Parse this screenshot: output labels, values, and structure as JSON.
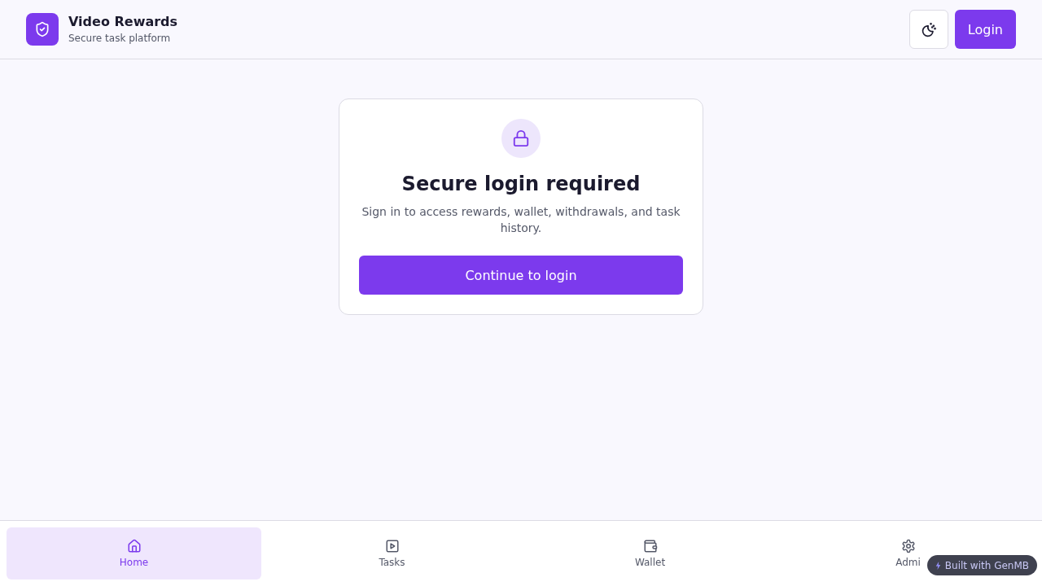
{
  "header": {
    "title": "Video Rewards",
    "subtitle": "Secure task platform",
    "login_button": "Login"
  },
  "card": {
    "title": "Secure login required",
    "description": "Sign in to access rewards, wallet, withdrawals, and task history.",
    "button": "Continue to login"
  },
  "bottom_nav": [
    {
      "label": "Home",
      "selected": true
    },
    {
      "label": "Tasks",
      "selected": false
    },
    {
      "label": "Wallet",
      "selected": false
    },
    {
      "label": "Admi",
      "selected": false
    }
  ],
  "badge": {
    "text": "Built with GenMB"
  }
}
